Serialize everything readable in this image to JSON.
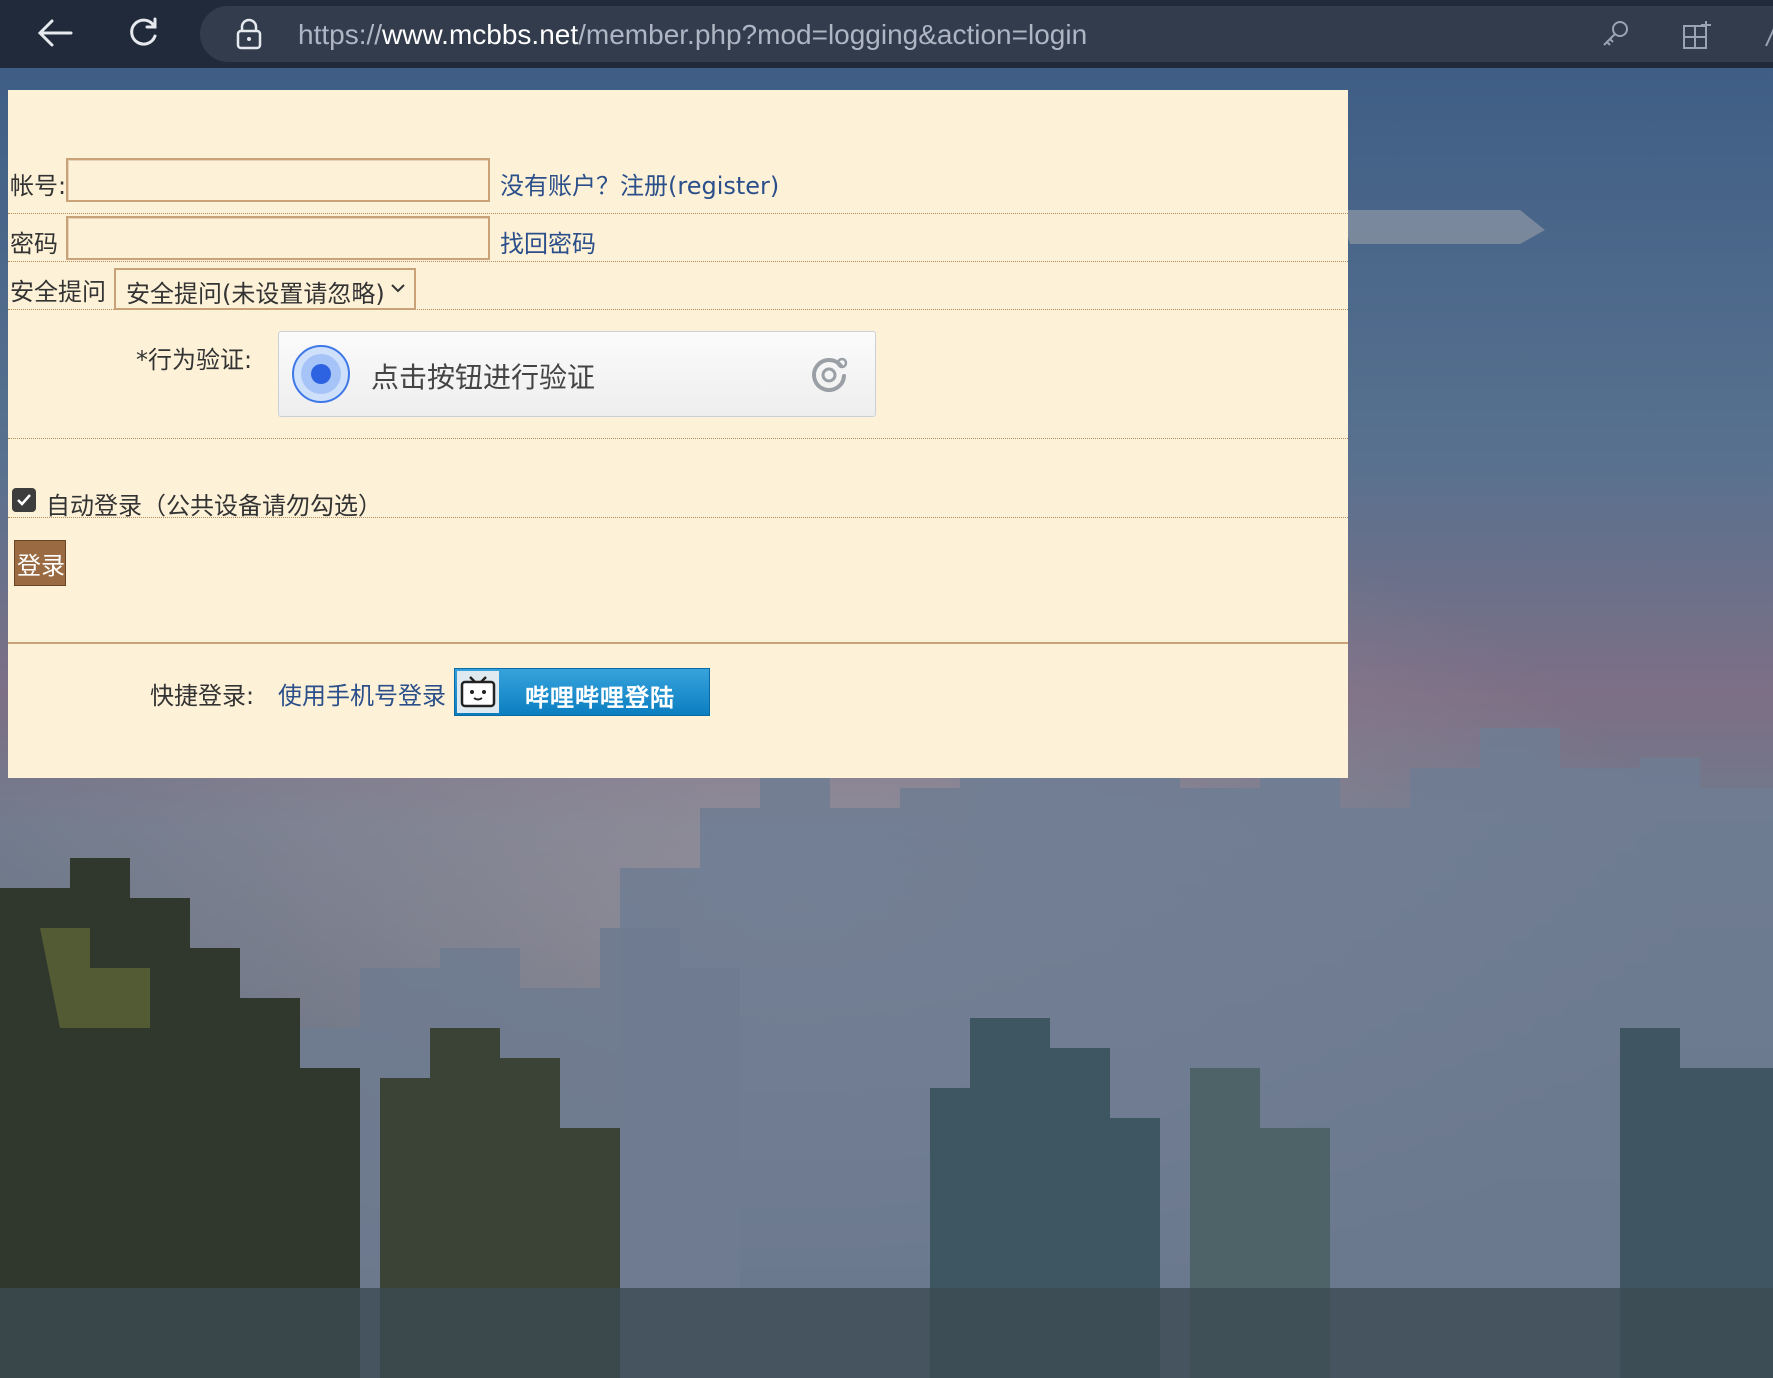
{
  "browser": {
    "url_scheme": "https://",
    "url_host": "www.mcbbs.net",
    "url_path": "/member.php?mod=logging&action=login"
  },
  "login": {
    "username_label": "帐号:",
    "username_value": "",
    "register_link": "没有账户？注册(register)",
    "password_label": "密码",
    "password_value": "",
    "recover_link": "找回密码",
    "security_label": "安全提问",
    "security_selected": "安全提问(未设置请忽略)",
    "verify_label": "*行为验证:",
    "verify_button": "点击按钮进行验证",
    "auto_login_checked": true,
    "auto_login_label": "自动登录（公共设备请勿勾选）",
    "submit_label": "登录",
    "quick_label": "快捷登录:",
    "phone_login_link": "使用手机号登录",
    "bilibili_login": "哔哩哔哩登陆"
  },
  "colors": {
    "panel_bg": "#fdf2d8",
    "link": "#2b4f8a",
    "login_button": "#9a6b43",
    "bilibili_blue": "#0b7ec0"
  }
}
